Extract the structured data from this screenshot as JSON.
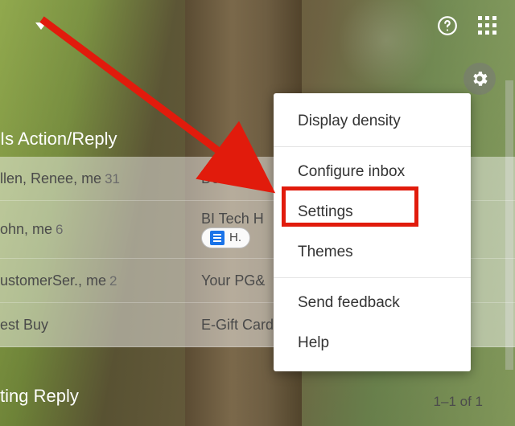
{
  "topbar": {
    "help_icon": "help-circle-icon",
    "apps_icon": "apps-grid-icon"
  },
  "gear_icon": "gear-icon",
  "section_title": "Is Action/Reply",
  "rows": [
    {
      "senders": "llen, Renee, me",
      "count": "31",
      "subject": "Devon De"
    },
    {
      "senders": "ohn, me",
      "count": "6",
      "subject": "BI Tech H",
      "chip": "H."
    },
    {
      "senders": "ustomerSer., me",
      "count": "2",
      "subject": "Your PG&"
    },
    {
      "senders": "est Buy",
      "count": "",
      "subject": "E-Gift Card  For  I  for or..."
    }
  ],
  "menu": {
    "items": [
      "Display density",
      "Configure inbox",
      "Settings",
      "Themes",
      "Send feedback",
      "Help"
    ]
  },
  "highlight_label_index": 2,
  "reply_tag": "ting Reply",
  "pager": "1–1 of 1"
}
